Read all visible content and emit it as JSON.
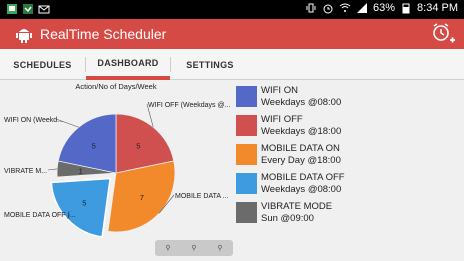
{
  "status": {
    "battery": "63%",
    "time": "8:34 PM"
  },
  "app": {
    "title": "RealTime Scheduler"
  },
  "tabs": [
    {
      "label": "SCHEDULES"
    },
    {
      "label": "DASHBOARD"
    },
    {
      "label": "SETTINGS"
    }
  ],
  "chart_data": {
    "type": "pie",
    "title": "Action/No of Days/Week",
    "categories": [
      "WIFI OFF (Weekdays @...",
      "MOBILE DATA ...",
      "MOBILE DATA OFF (...",
      "VIBRATE M...",
      "WIFI ON (Weekd..."
    ],
    "values": [
      5,
      7,
      5,
      1,
      5
    ],
    "colors": [
      "#d04f4f",
      "#f28a2c",
      "#3e9be0",
      "#6b6b6b",
      "#5468c7"
    ]
  },
  "legend": [
    {
      "line1": "WIFI ON",
      "line2": "Weekdays @08:00",
      "color": "#5468c7"
    },
    {
      "line1": "WIFI OFF",
      "line2": "Weekdays @18:00",
      "color": "#d04f4f"
    },
    {
      "line1": "MOBILE DATA ON",
      "line2": "Every Day @18:00",
      "color": "#f28a2c"
    },
    {
      "line1": "MOBILE DATA OFF",
      "line2": "Weekdays @08:00",
      "color": "#3e9be0"
    },
    {
      "line1": "VIBRATE MODE",
      "line2": "Sun @09:00",
      "color": "#6b6b6b"
    }
  ],
  "zoom": [
    "zoom-out-icon",
    "zoom-reset-icon",
    "zoom-in-icon"
  ]
}
